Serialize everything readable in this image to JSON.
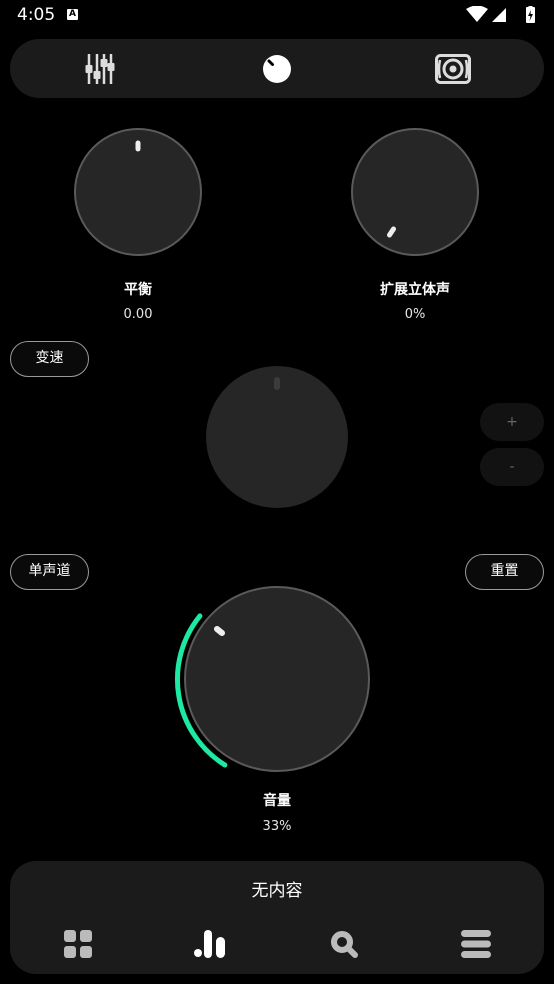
{
  "status_bar": {
    "time": "4:05",
    "notification_badge": "A",
    "icons": [
      "wifi-icon",
      "signal-icon",
      "battery-charging-icon"
    ]
  },
  "top_tabs": [
    {
      "name": "equalizer",
      "icon": "equalizer-sliders-icon",
      "active": false
    },
    {
      "name": "knobs",
      "icon": "knob-icon",
      "active": true
    },
    {
      "name": "speaker",
      "icon": "speaker-icon",
      "active": false
    }
  ],
  "knobs": {
    "balance": {
      "label": "平衡",
      "value": "0.00"
    },
    "stereo_width": {
      "label": "扩展立体声",
      "value": "0%"
    },
    "tempo": {
      "label": "",
      "value": ""
    },
    "volume": {
      "label": "音量",
      "value": "33%"
    }
  },
  "buttons": {
    "tempo": "变速",
    "mono": "单声道",
    "reset": "重置",
    "plus": "+",
    "minus": "-"
  },
  "player": {
    "now_playing": "无内容"
  },
  "bottom_nav": [
    {
      "name": "library",
      "icon": "grid-icon"
    },
    {
      "name": "effects",
      "icon": "bars-icon",
      "active": true
    },
    {
      "name": "search",
      "icon": "search-icon"
    },
    {
      "name": "queue",
      "icon": "list-icon"
    }
  ],
  "colors": {
    "accent": "#1de9a6",
    "panel": "#1b1b1b",
    "knob_fill": "#262626",
    "knob_border": "#5a5a5a"
  }
}
